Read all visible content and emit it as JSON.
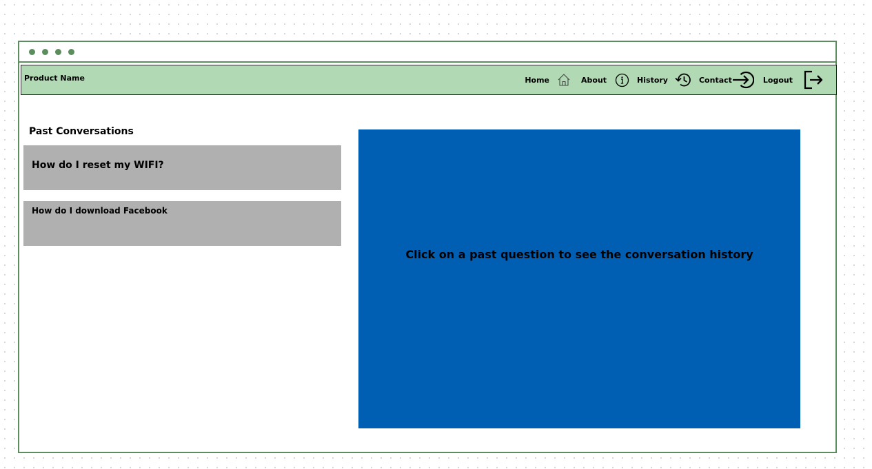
{
  "window": {
    "accent_color": "#5b8d5f"
  },
  "navbar": {
    "product_name": "Product Name",
    "background_color": "#b1dab4",
    "items": [
      {
        "label": "Home",
        "icon": "home-icon"
      },
      {
        "label": "About",
        "icon": "info-icon"
      },
      {
        "label": "History",
        "icon": "history-icon"
      },
      {
        "label": "Contact",
        "icon": "arrow-circle-right-icon"
      },
      {
        "label": "Logout",
        "icon": "logout-icon"
      }
    ]
  },
  "sidebar": {
    "title": "Past Conversations",
    "conversations": [
      {
        "label": "How do I reset my WIFI?"
      },
      {
        "label": "How do I download Facebook"
      }
    ],
    "item_color": "#b0b0b0"
  },
  "history_panel": {
    "message": "Click on a past question to see the conversation history",
    "background_color": "#005eb3"
  }
}
